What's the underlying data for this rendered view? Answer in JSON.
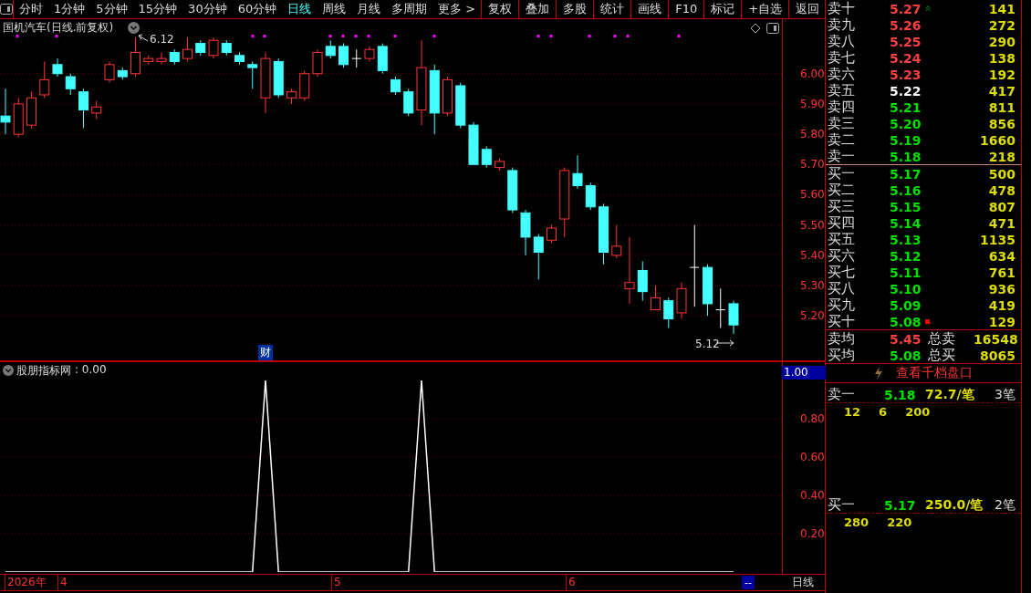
{
  "toolbar": {
    "periods": [
      {
        "label": "分时",
        "selected": false
      },
      {
        "label": "1分钟",
        "selected": false
      },
      {
        "label": "5分钟",
        "selected": false
      },
      {
        "label": "15分钟",
        "selected": false
      },
      {
        "label": "30分钟",
        "selected": false
      },
      {
        "label": "60分钟",
        "selected": false
      },
      {
        "label": "日线",
        "selected": true
      },
      {
        "label": "周线",
        "selected": false
      },
      {
        "label": "月线",
        "selected": false
      },
      {
        "label": "多周期",
        "selected": false
      },
      {
        "label": "更多 >",
        "selected": false
      }
    ],
    "buttons": [
      "复权",
      "叠加",
      "多股",
      "统计",
      "画线",
      "F10",
      "标记",
      "+自选",
      "返回"
    ]
  },
  "chart": {
    "title": "国机汽车(日线.前复权)",
    "high_label": "6.12",
    "low_label": "5.12",
    "badge": "财",
    "chart_data": {
      "type": "candlestick",
      "grid": true,
      "ylim": [
        5.05,
        6.18
      ],
      "yticks": [
        {
          "value": 6.0,
          "label": "6.00"
        },
        {
          "value": 5.9,
          "label": "5.90"
        },
        {
          "value": 5.8,
          "label": "5.80"
        },
        {
          "value": 5.7,
          "label": "5.70"
        },
        {
          "value": 5.6,
          "label": "5.60"
        },
        {
          "value": 5.5,
          "label": "5.50"
        },
        {
          "value": 5.4,
          "label": "5.40"
        },
        {
          "value": 5.3,
          "label": "5.30"
        },
        {
          "value": 5.2,
          "label": "5.20"
        }
      ],
      "ohlc": [
        [
          5.86,
          5.95,
          5.8,
          5.84
        ],
        [
          5.8,
          5.92,
          5.79,
          5.9
        ],
        [
          5.83,
          5.94,
          5.82,
          5.92
        ],
        [
          5.93,
          6.04,
          5.92,
          5.98
        ],
        [
          6.03,
          6.05,
          5.99,
          6.0
        ],
        [
          5.99,
          6.0,
          5.93,
          5.95
        ],
        [
          5.94,
          5.95,
          5.82,
          5.88
        ],
        [
          5.87,
          5.91,
          5.85,
          5.89
        ],
        [
          5.98,
          6.04,
          5.97,
          6.03
        ],
        [
          6.01,
          6.02,
          5.98,
          5.99
        ],
        [
          6.0,
          6.12,
          5.99,
          6.07
        ],
        [
          6.04,
          6.06,
          6.03,
          6.05
        ],
        [
          6.04,
          6.07,
          6.03,
          6.05
        ],
        [
          6.07,
          6.08,
          6.03,
          6.04
        ],
        [
          6.05,
          6.12,
          6.04,
          6.08
        ],
        [
          6.1,
          6.11,
          6.06,
          6.07
        ],
        [
          6.06,
          6.12,
          6.05,
          6.11
        ],
        [
          6.1,
          6.11,
          6.06,
          6.07
        ],
        [
          6.06,
          6.07,
          6.03,
          6.04
        ],
        [
          6.03,
          6.04,
          5.95,
          6.02
        ],
        [
          5.92,
          6.07,
          5.87,
          6.05
        ],
        [
          6.04,
          6.05,
          5.92,
          5.93
        ],
        [
          5.92,
          5.95,
          5.9,
          5.94
        ],
        [
          5.92,
          6.01,
          5.91,
          6.0
        ],
        [
          6.0,
          6.08,
          5.99,
          6.07
        ],
        [
          6.09,
          6.11,
          6.05,
          6.06
        ],
        [
          6.09,
          6.1,
          6.02,
          6.03
        ],
        [
          6.05,
          6.08,
          6.02,
          6.05
        ],
        [
          6.05,
          6.09,
          6.04,
          6.08
        ],
        [
          6.09,
          6.1,
          6.0,
          6.01
        ],
        [
          5.98,
          5.99,
          5.93,
          5.94
        ],
        [
          5.94,
          5.95,
          5.86,
          5.87
        ],
        [
          5.88,
          6.11,
          5.83,
          6.02
        ],
        [
          6.01,
          6.03,
          5.8,
          5.87
        ],
        [
          5.87,
          5.99,
          5.86,
          5.98
        ],
        [
          5.96,
          5.97,
          5.82,
          5.83
        ],
        [
          5.83,
          5.84,
          5.7,
          5.7
        ],
        [
          5.75,
          5.76,
          5.69,
          5.7
        ],
        [
          5.69,
          5.72,
          5.68,
          5.71
        ],
        [
          5.68,
          5.69,
          5.54,
          5.55
        ],
        [
          5.54,
          5.55,
          5.4,
          5.46
        ],
        [
          5.46,
          5.47,
          5.32,
          5.41
        ],
        [
          5.45,
          5.5,
          5.44,
          5.49
        ],
        [
          5.52,
          5.69,
          5.46,
          5.68
        ],
        [
          5.67,
          5.73,
          5.62,
          5.63
        ],
        [
          5.63,
          5.64,
          5.55,
          5.56
        ],
        [
          5.56,
          5.57,
          5.37,
          5.41
        ],
        [
          5.4,
          5.5,
          5.39,
          5.43
        ],
        [
          5.29,
          5.46,
          5.24,
          5.31
        ],
        [
          5.35,
          5.38,
          5.25,
          5.28
        ],
        [
          5.22,
          5.3,
          5.22,
          5.26
        ],
        [
          5.25,
          5.26,
          5.16,
          5.19
        ],
        [
          5.21,
          5.31,
          5.19,
          5.29
        ],
        [
          5.36,
          5.5,
          5.23,
          5.36
        ],
        [
          5.36,
          5.37,
          5.2,
          5.24
        ],
        [
          5.22,
          5.29,
          5.16,
          5.22
        ],
        [
          5.24,
          5.25,
          5.14,
          5.17
        ]
      ]
    }
  },
  "indicator": {
    "reading": ": 0.00",
    "current_label": "1.00",
    "chart_data": {
      "type": "line",
      "grid": true,
      "ylim": [
        0,
        1.1
      ],
      "yticks": [
        {
          "value": 0.2,
          "label": "0.20"
        },
        {
          "value": 0.4,
          "label": "0.40"
        },
        {
          "value": 0.6,
          "label": "0.60"
        },
        {
          "value": 0.8,
          "label": "0.80"
        }
      ],
      "series": [
        {
          "name": "股朋指标网",
          "color": "#ffffff",
          "values": [
            0,
            0,
            0,
            0,
            0,
            0,
            0,
            0,
            0,
            0,
            0,
            0,
            0,
            0,
            0,
            0,
            0,
            0,
            0,
            0,
            1,
            0,
            0,
            0,
            0,
            0,
            0,
            0,
            0,
            0,
            0,
            0,
            1,
            0,
            0,
            0,
            0,
            0,
            0,
            0,
            0,
            0,
            0,
            0,
            0,
            0,
            0,
            0,
            0,
            0,
            0,
            0,
            0,
            0,
            0,
            0,
            0
          ]
        }
      ]
    }
  },
  "time_axis": {
    "labels": [
      "2026年",
      "4",
      "5",
      "6"
    ],
    "cursor": "--",
    "period": "日线"
  },
  "order_book": {
    "asks": [
      {
        "label": "卖十",
        "price": "5.27",
        "volume": "141",
        "color": "#ff4040",
        "trend_icon": true
      },
      {
        "label": "卖九",
        "price": "5.26",
        "volume": "272",
        "color": "#ff4040"
      },
      {
        "label": "卖八",
        "price": "5.25",
        "volume": "290",
        "color": "#ff4040"
      },
      {
        "label": "卖七",
        "price": "5.24",
        "volume": "138",
        "color": "#ff4040"
      },
      {
        "label": "卖六",
        "price": "5.23",
        "volume": "192",
        "color": "#ff4040"
      },
      {
        "label": "卖五",
        "price": "5.22",
        "volume": "417",
        "color": "#ffffff"
      },
      {
        "label": "卖四",
        "price": "5.21",
        "volume": "811",
        "color": "#00e000"
      },
      {
        "label": "卖三",
        "price": "5.20",
        "volume": "856",
        "color": "#00e000"
      },
      {
        "label": "卖二",
        "price": "5.19",
        "volume": "1660",
        "color": "#00e000"
      },
      {
        "label": "卖一",
        "price": "5.18",
        "volume": "218",
        "color": "#00e000"
      }
    ],
    "bids": [
      {
        "label": "买一",
        "price": "5.17",
        "volume": "500",
        "color": "#00e000"
      },
      {
        "label": "买二",
        "price": "5.16",
        "volume": "478",
        "color": "#00e000"
      },
      {
        "label": "买三",
        "price": "5.15",
        "volume": "807",
        "color": "#00e000"
      },
      {
        "label": "买四",
        "price": "5.14",
        "volume": "471",
        "color": "#00e000"
      },
      {
        "label": "买五",
        "price": "5.13",
        "volume": "1135",
        "color": "#00e000"
      },
      {
        "label": "买六",
        "price": "5.12",
        "volume": "634",
        "color": "#00e000"
      },
      {
        "label": "买七",
        "price": "5.11",
        "volume": "761",
        "color": "#00e000"
      },
      {
        "label": "买八",
        "price": "5.10",
        "volume": "936",
        "color": "#00e000"
      },
      {
        "label": "买九",
        "price": "5.09",
        "volume": "419",
        "color": "#00e000"
      },
      {
        "label": "买十",
        "price": "5.08",
        "volume": "129",
        "color": "#00e000",
        "flag_icon": true
      }
    ],
    "summary": [
      {
        "label": "卖均",
        "price": "5.45",
        "color": "#ff4040",
        "total_label": "总卖",
        "total": "16548"
      },
      {
        "label": "买均",
        "price": "5.08",
        "color": "#00e000",
        "total_label": "总买",
        "total": "8065"
      }
    ],
    "depth_link": "查看千档盘口"
  },
  "queues": [
    {
      "label": "卖一",
      "price": "5.18",
      "average": "72.7/笔",
      "count": "3笔",
      "orders": [
        "12",
        "6",
        "200"
      ]
    },
    {
      "label": "买一",
      "price": "5.17",
      "average": "250.0/笔",
      "count": "2笔",
      "orders": [
        "280",
        "220"
      ]
    }
  ]
}
